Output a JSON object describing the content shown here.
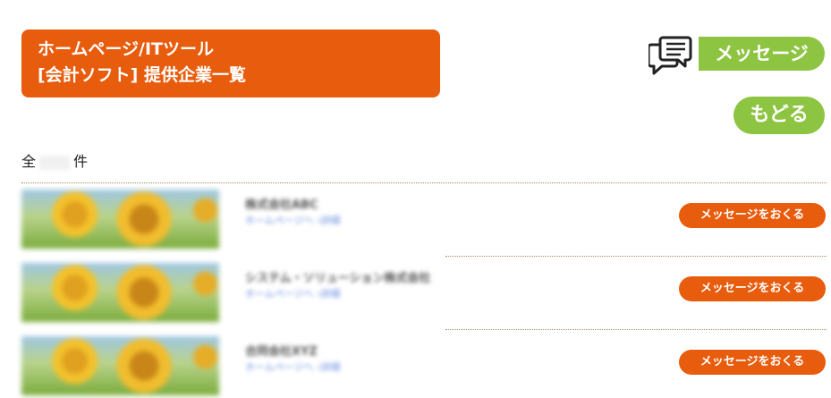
{
  "title": {
    "line1": "ホームページ/ITツール",
    "line2": "[会計ソフト] 提供企業一覧"
  },
  "message_link": {
    "label": "メッセージ",
    "icon": "speech-bubbles-icon"
  },
  "back_button": {
    "label": "もどる"
  },
  "count": {
    "prefix": "全",
    "suffix": "件"
  },
  "colors": {
    "accent_orange": "#e85c0d",
    "accent_green": "#8dc441"
  },
  "companies": [
    {
      "name": "株式会社ABC",
      "link": "ホームページへ ›詳細",
      "button": "メッセージをおくる"
    },
    {
      "name": "システム・ソリューション株式会社",
      "link": "ホームページへ ›詳細",
      "button": "メッセージをおくる"
    },
    {
      "name": "合同会社XYZ",
      "link": "ホームページへ ›詳細",
      "button": "メッセージをおくる"
    }
  ]
}
